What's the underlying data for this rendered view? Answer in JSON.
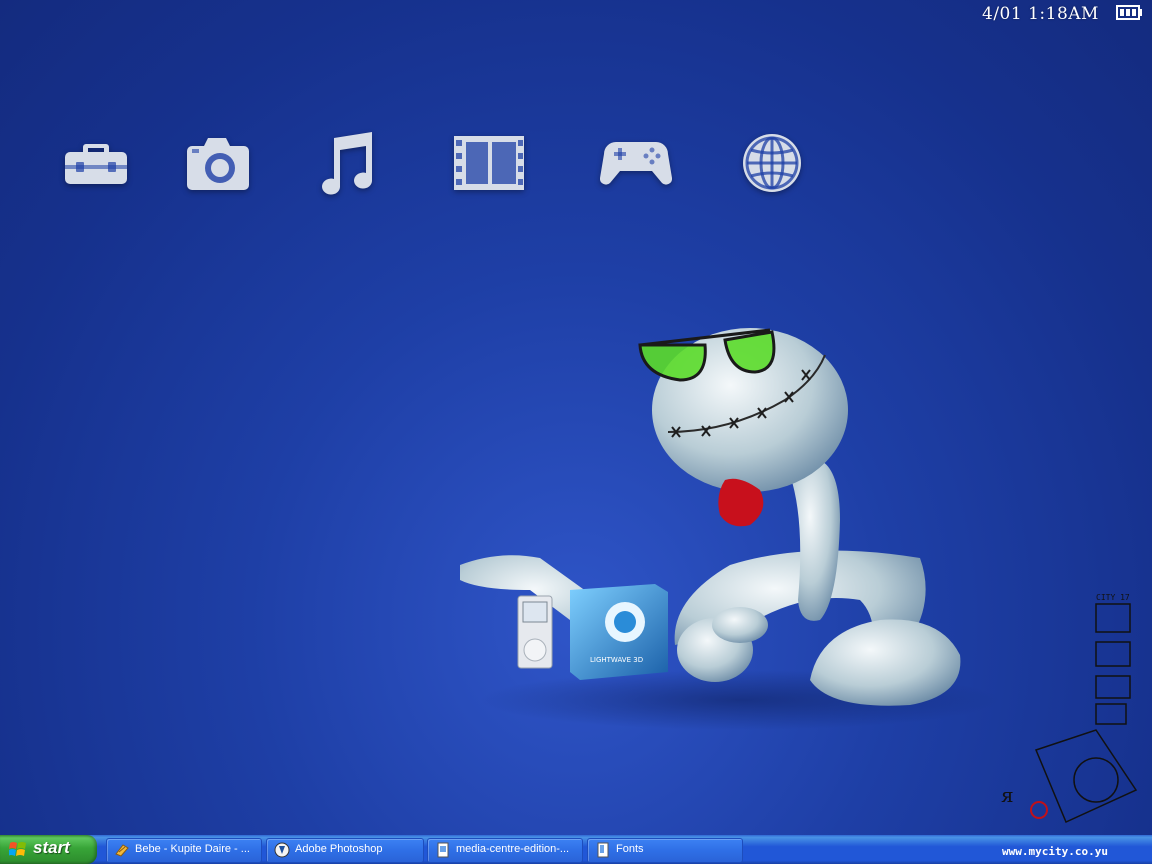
{
  "status": {
    "clock": "4/01 1:18AM",
    "battery_icon": "battery-full-icon"
  },
  "xmb_icons": [
    {
      "name": "toolbox-icon"
    },
    {
      "name": "camera-icon"
    },
    {
      "name": "music-note-icon"
    },
    {
      "name": "film-icon"
    },
    {
      "name": "gamepad-icon"
    },
    {
      "name": "globe-icon"
    }
  ],
  "wallpaper": {
    "box_label": "LIGHTWAVE 3D",
    "city_label": "CITY 17",
    "watermark": "www.mycity.co.yu"
  },
  "taskbar": {
    "start_label": "start",
    "tasks": [
      {
        "label": "Bebe - Kupite Daire - ...",
        "icon": "media-player-icon"
      },
      {
        "label": "Adobe Photoshop",
        "icon": "photoshop-icon"
      },
      {
        "label": "media-centre-edition-...",
        "icon": "image-file-icon"
      },
      {
        "label": "Fonts",
        "icon": "folder-icon"
      }
    ]
  },
  "colors": {
    "background": "#1e3fa6",
    "taskbar": "#2157d7",
    "start_button": "#38a538",
    "icon_fill": "#d7dde8"
  }
}
